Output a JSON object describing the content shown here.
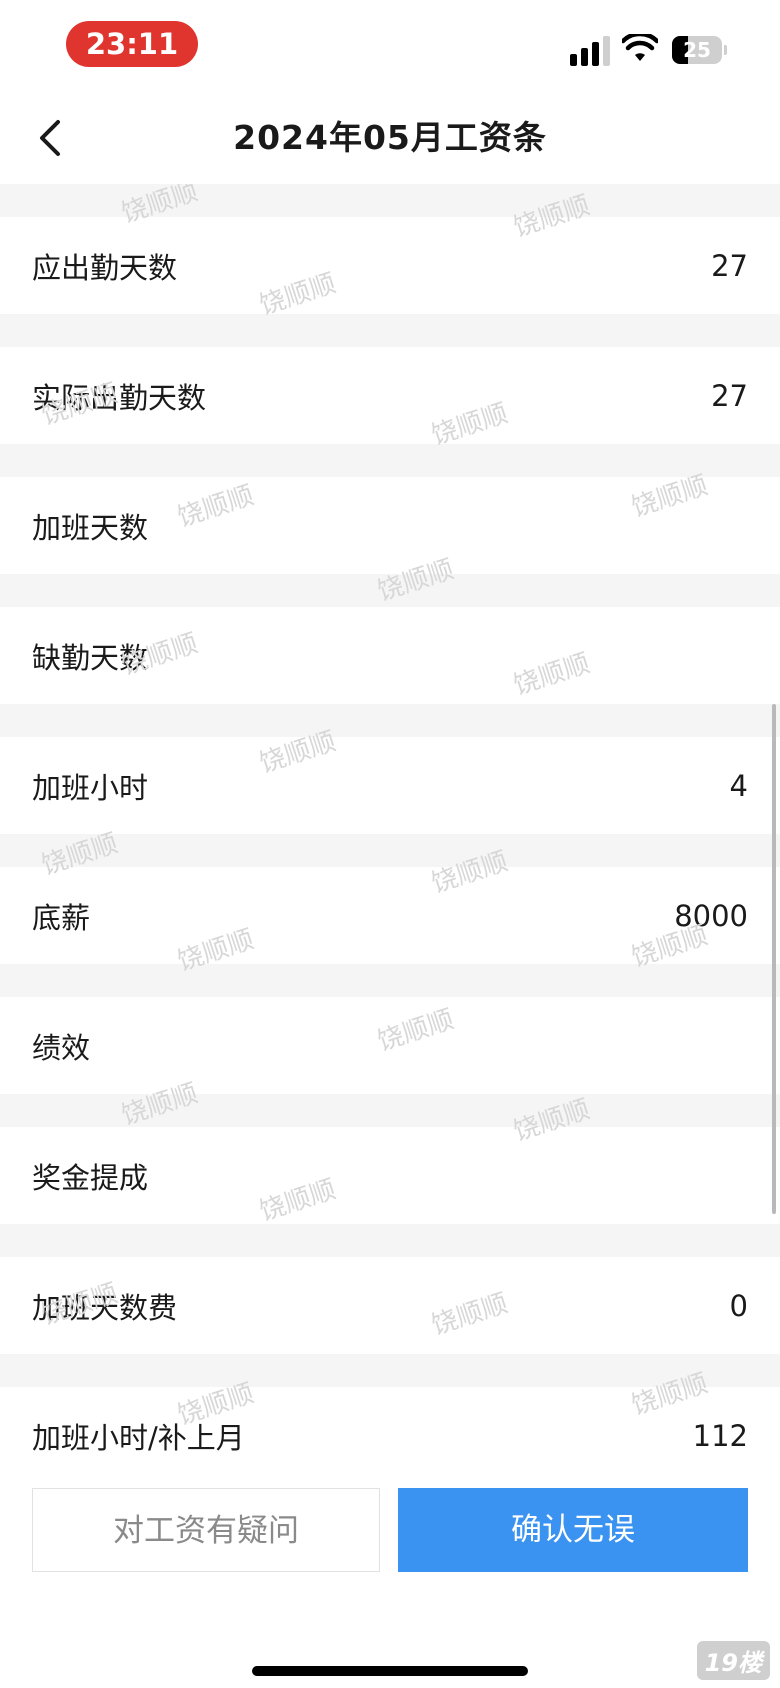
{
  "status_bar": {
    "time": "23:11",
    "battery": "25"
  },
  "header": {
    "title": "2024年05月工资条"
  },
  "rows": [
    {
      "label": "应出勤天数",
      "value": "27"
    },
    {
      "label": "实际出勤天数",
      "value": "27"
    },
    {
      "label": "加班天数",
      "value": ""
    },
    {
      "label": "缺勤天数",
      "value": ""
    },
    {
      "label": "加班小时",
      "value": "4"
    },
    {
      "label": "底薪",
      "value": "8000"
    },
    {
      "label": "绩效",
      "value": ""
    },
    {
      "label": "奖金提成",
      "value": ""
    },
    {
      "label": "加班天数费",
      "value": "0"
    },
    {
      "label": "加班小时/补上月",
      "value": "112"
    }
  ],
  "watermark": "饶顺顺",
  "footer": {
    "question_label": "对工资有疑问",
    "confirm_label": "确认无误"
  },
  "logo": "19楼",
  "colors": {
    "accent": "#3a93f0",
    "time_pill": "#e0342e",
    "row_gap": "#f5f5f5"
  }
}
